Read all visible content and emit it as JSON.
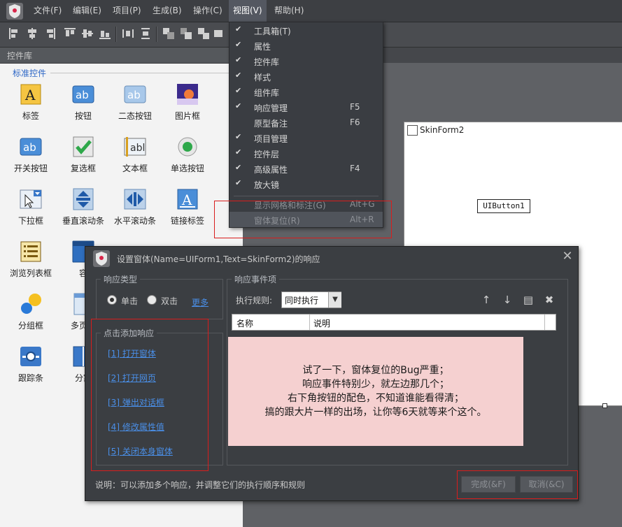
{
  "menubar": {
    "items": [
      "文件(F)",
      "编辑(E)",
      "项目(P)",
      "生成(B)",
      "操作(C)",
      "视图(V)",
      "帮助(H)"
    ]
  },
  "panel": {
    "title": "控件库",
    "group": "标准控件",
    "controls": [
      "标签",
      "按钮",
      "二态按钮",
      "图片框",
      "开关按钮",
      "复选框",
      "文本框",
      "单选按钮",
      "下拉框",
      "垂直滚动条",
      "水平滚动条",
      "链接标签",
      "浏览列表框",
      "容",
      "",
      "",
      "分组框",
      "多页面",
      "",
      "",
      "跟踪条",
      "分割"
    ]
  },
  "view_menu": {
    "items": [
      {
        "label": "工具箱(T)",
        "checked": true,
        "shortcut": ""
      },
      {
        "label": "属性",
        "checked": true,
        "shortcut": ""
      },
      {
        "label": "控件库",
        "checked": true,
        "shortcut": ""
      },
      {
        "label": "样式",
        "checked": true,
        "shortcut": ""
      },
      {
        "label": "组件库",
        "checked": true,
        "shortcut": ""
      },
      {
        "label": "响应管理",
        "checked": true,
        "shortcut": "F5"
      },
      {
        "label": "原型备注",
        "checked": false,
        "shortcut": "F6"
      },
      {
        "label": "项目管理",
        "checked": true,
        "shortcut": ""
      },
      {
        "label": "控件层",
        "checked": true,
        "shortcut": ""
      },
      {
        "label": "高级属性",
        "checked": true,
        "shortcut": "F4"
      },
      {
        "label": "放大镜",
        "checked": true,
        "shortcut": ""
      }
    ],
    "items2": [
      {
        "label": "显示网格和标注(G)",
        "shortcut": "Alt+G"
      },
      {
        "label": "窗体复位(R)",
        "shortcut": "Alt+R"
      }
    ]
  },
  "design": {
    "form_title": "SkinForm2",
    "button_text": "UIButton1"
  },
  "dialog": {
    "title": "设置窗体(Name=UIForm1,Text=SkinForm2)的响应",
    "response_type": {
      "legend": "响应类型",
      "single": "单击",
      "double": "双击",
      "more": "更多"
    },
    "add_response": {
      "legend": "点击添加响应",
      "links": [
        "[1] 打开窗体",
        "[2] 打开网页",
        "[3] 弹出对话框",
        "[4] 修改属性值",
        "[5] 关闭本身窗体"
      ]
    },
    "events": {
      "legend": "响应事件项",
      "rule_label": "执行规则:",
      "rule_value": "同时执行",
      "col_name": "名称",
      "col_desc": "说明"
    },
    "note_lines": [
      "试了一下，窗体复位的Bug严重；",
      "响应事件特别少，就左边那几个；",
      "右下角按钮的配色，不知道谁能看得清；",
      "搞的跟大片一样的出场，让你等6天就等来个这个。"
    ],
    "description": "说明：可以添加多个响应，并调整它们的执行顺序和规则",
    "ok_label": "完成(&F)",
    "cancel_label": "取消(&C)"
  }
}
